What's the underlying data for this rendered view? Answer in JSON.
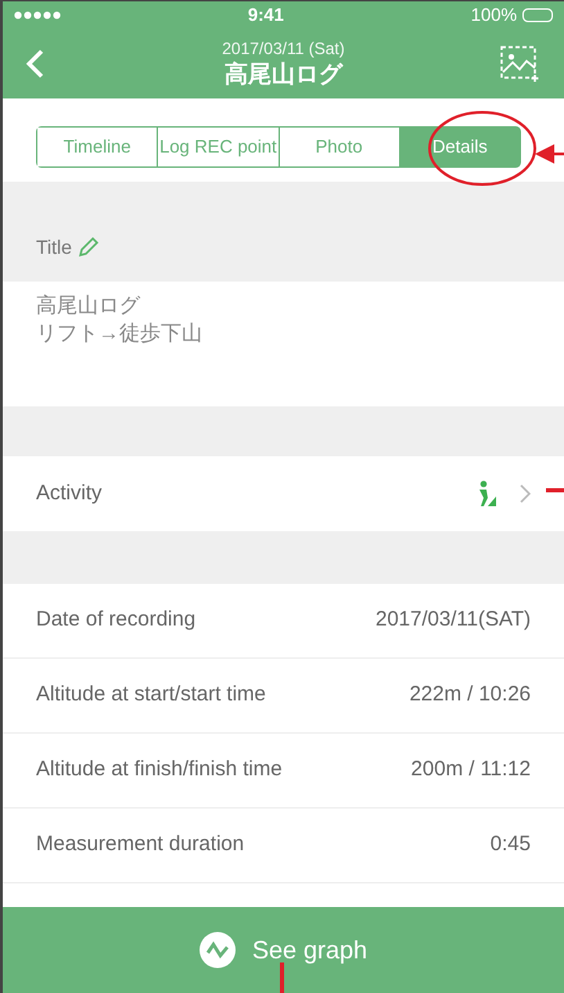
{
  "status_bar": {
    "time": "9:41",
    "battery": "100%"
  },
  "nav": {
    "date": "2017/03/11 (Sat)",
    "title": "高尾山ログ"
  },
  "tabs": [
    {
      "label": "Timeline",
      "selected": false
    },
    {
      "label": "Log REC point",
      "selected": false
    },
    {
      "label": "Photo",
      "selected": false
    },
    {
      "label": "Details",
      "selected": true
    }
  ],
  "title_section": {
    "label": "Title",
    "value": [
      "高尾山ログ",
      "リフト→徒歩下山"
    ]
  },
  "activity": {
    "label": "Activity"
  },
  "details": [
    {
      "label": "Date of recording",
      "value": "2017/03/11(SAT)"
    },
    {
      "label": "Altitude at start/start time",
      "value": "222m / 10:26"
    },
    {
      "label": "Altitude at finish/finish time",
      "value": "200m / 11:12"
    },
    {
      "label": "Measurement duration",
      "value": "0:45"
    }
  ],
  "graph_button": {
    "label": "See graph"
  }
}
